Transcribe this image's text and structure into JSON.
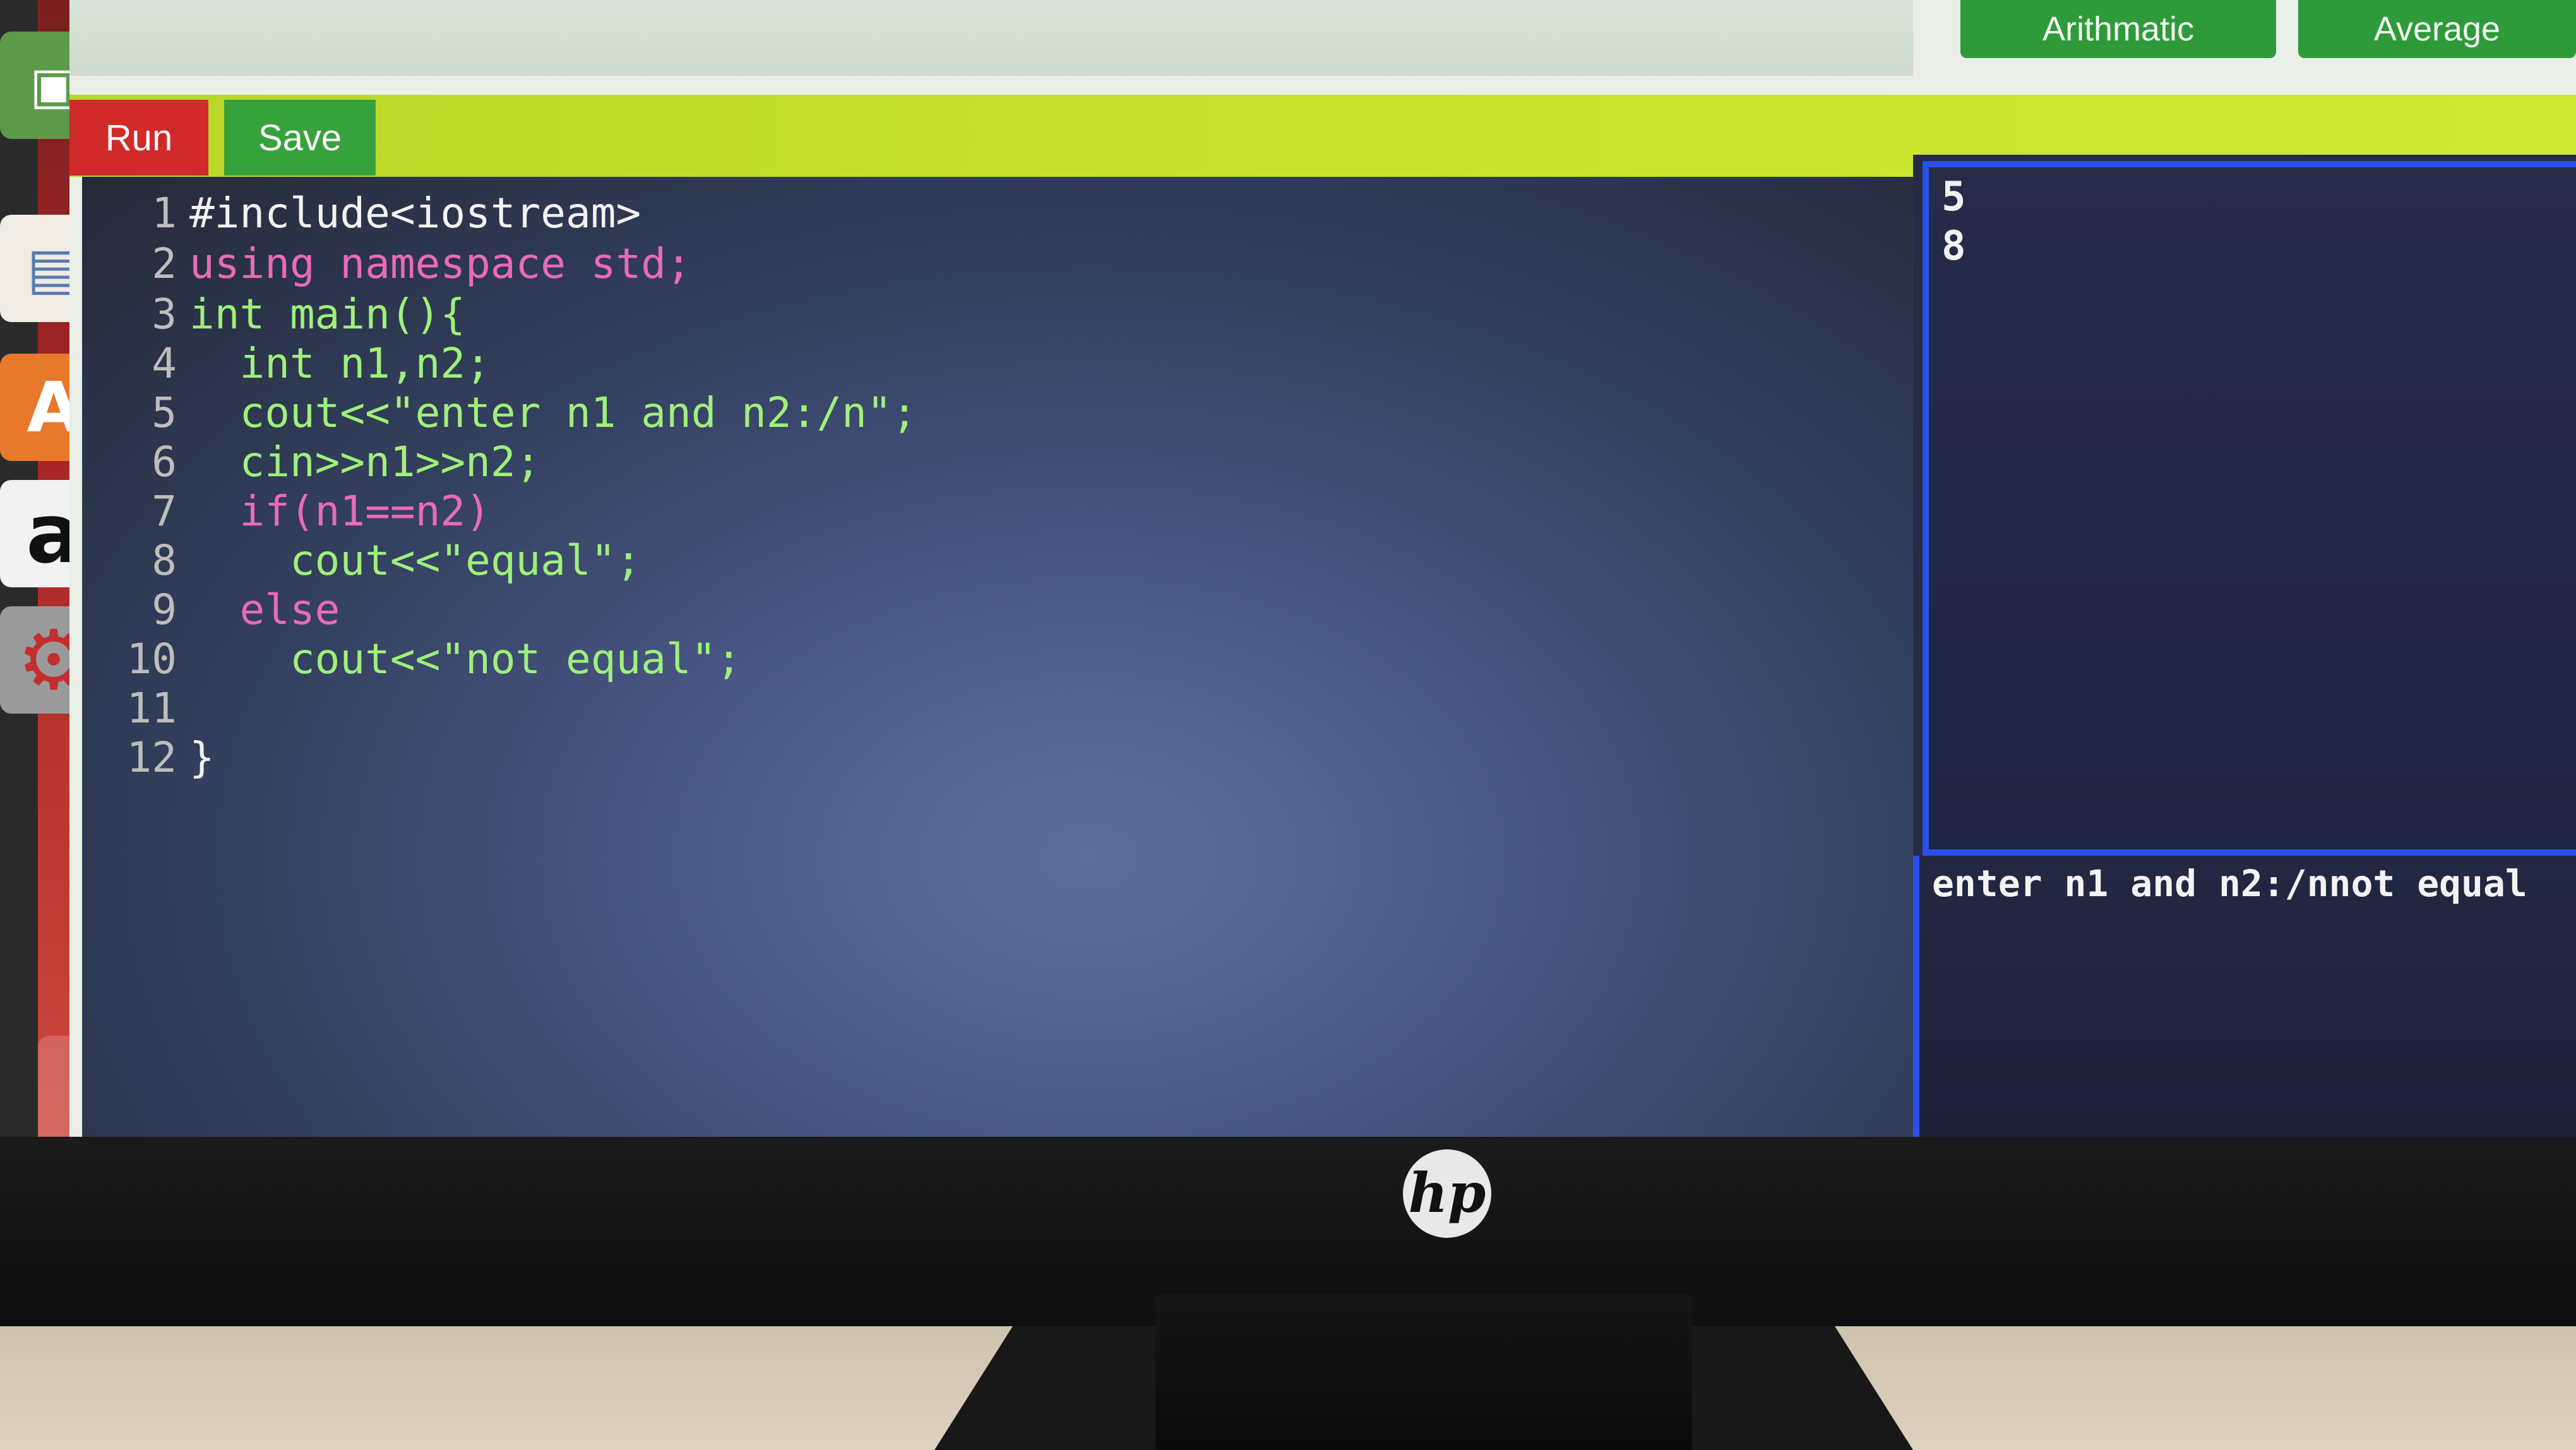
{
  "top_bar": {
    "buttons": [
      {
        "label": "Arithmatic"
      },
      {
        "label": "Average"
      }
    ]
  },
  "toolbar": {
    "run_label": "Run",
    "save_label": "Save"
  },
  "editor": {
    "lines": [
      {
        "num": "1",
        "text": "#include<iostream>"
      },
      {
        "num": "2",
        "text": "using namespace std;"
      },
      {
        "num": "3",
        "text": "int main(){"
      },
      {
        "num": "4",
        "text": "  int n1,n2;"
      },
      {
        "num": "5",
        "text": "  cout<<\"enter n1 and n2:/n\";"
      },
      {
        "num": "6",
        "text": "  cin>>n1>>n2;"
      },
      {
        "num": "7",
        "text": "  if(n1==n2)"
      },
      {
        "num": "8",
        "text": "    cout<<\"equal\";"
      },
      {
        "num": "9",
        "text": "  else"
      },
      {
        "num": "10",
        "text": "    cout<<\"not equal\";"
      },
      {
        "num": "11",
        "text": ""
      },
      {
        "num": "12",
        "text": "}"
      }
    ]
  },
  "input_pane": {
    "lines": [
      "5",
      "8"
    ]
  },
  "output_pane": {
    "text": "enter n1 and n2:/nnot equal"
  },
  "launcher": {
    "icons": [
      "files-icon",
      "writer-icon",
      "software-center-icon",
      "amazon-icon",
      "settings-icon",
      "trash-icon"
    ]
  },
  "monitor": {
    "brand": "hp"
  },
  "colors": {
    "run": "#d12a2a",
    "save": "#37a23c",
    "toolbar": "#c8e22c",
    "top_buttons": "#2f9a3a",
    "pane_border": "#2a4ee8"
  }
}
